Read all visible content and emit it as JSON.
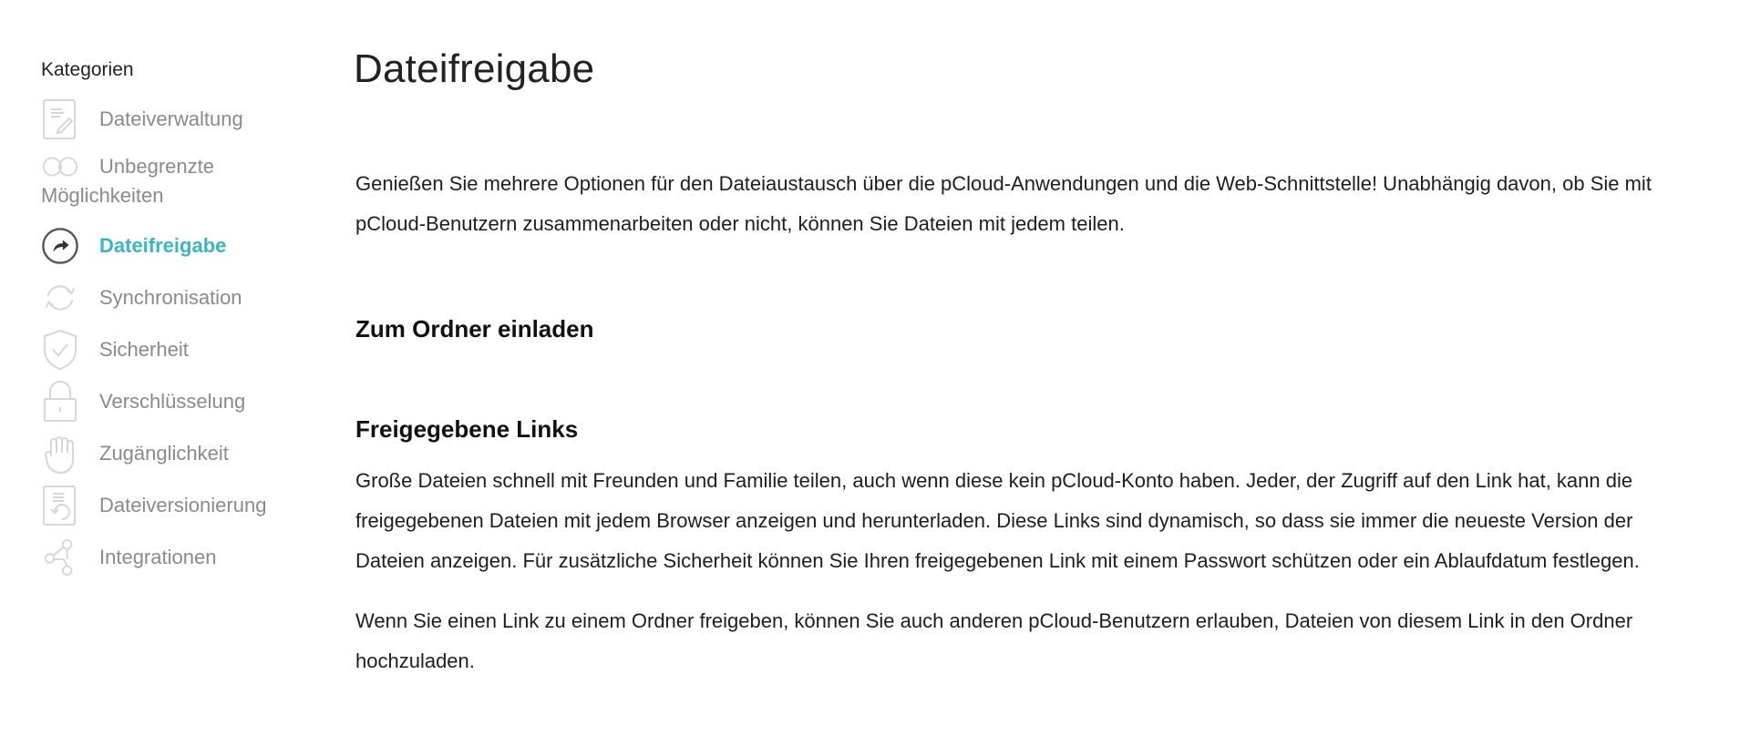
{
  "sidebar": {
    "title": "Kategorien",
    "items": [
      {
        "label": "Dateiverwaltung",
        "icon": "document-edit-icon",
        "active": false
      },
      {
        "label": "Unbegrenzte",
        "label_continuation": "Möglichkeiten",
        "icon": "infinity-icon",
        "active": false
      },
      {
        "label": "Dateifreigabe",
        "icon": "share-arrow-icon",
        "active": true
      },
      {
        "label": "Synchronisation",
        "icon": "sync-icon",
        "active": false
      },
      {
        "label": "Sicherheit",
        "icon": "shield-check-icon",
        "active": false
      },
      {
        "label": "Verschlüsselung",
        "icon": "lock-icon",
        "active": false
      },
      {
        "label": "Zugänglichkeit",
        "icon": "hand-icon",
        "active": false
      },
      {
        "label": "Dateiversionierung",
        "icon": "document-restore-icon",
        "active": false
      },
      {
        "label": "Integrationen",
        "icon": "integrations-icon",
        "active": false
      }
    ]
  },
  "main": {
    "title": "Dateifreigabe",
    "intro": "Genießen Sie mehrere Optionen für den Dateiaustausch über die pCloud-Anwendungen und die Web-Schnittstelle! Unabhängig davon, ob Sie mit pCloud-Benutzern zusammenarbeiten oder nicht, können Sie Dateien mit jedem teilen.",
    "sections": [
      {
        "heading": "Zum Ordner einladen",
        "paragraphs": []
      },
      {
        "heading": "Freigegebene Links",
        "paragraphs": [
          "Große Dateien schnell mit Freunden und Familie teilen, auch wenn diese kein pCloud-Konto haben. Jeder, der Zugriff auf den Link hat, kann die freigegebenen Dateien mit jedem Browser anzeigen und herunterladen. Diese Links sind dynamisch, so dass sie immer die neueste Version der Dateien anzeigen. Für zusätzliche Sicherheit können Sie Ihren freigegebenen Link mit einem Passwort schützen oder ein Ablaufdatum festlegen.",
          "Wenn Sie einen Link zu einem Ordner freigeben, können Sie auch anderen pCloud-Benutzern erlauben, Dateien von diesem Link in den Ordner hochzuladen."
        ]
      }
    ]
  },
  "colors": {
    "accent": "#3ab5c4",
    "inactive_text": "#8a8a8a",
    "inactive_icon": "#d6d6d6",
    "active_icon": "#555555",
    "body_text": "#1e1e1e"
  }
}
